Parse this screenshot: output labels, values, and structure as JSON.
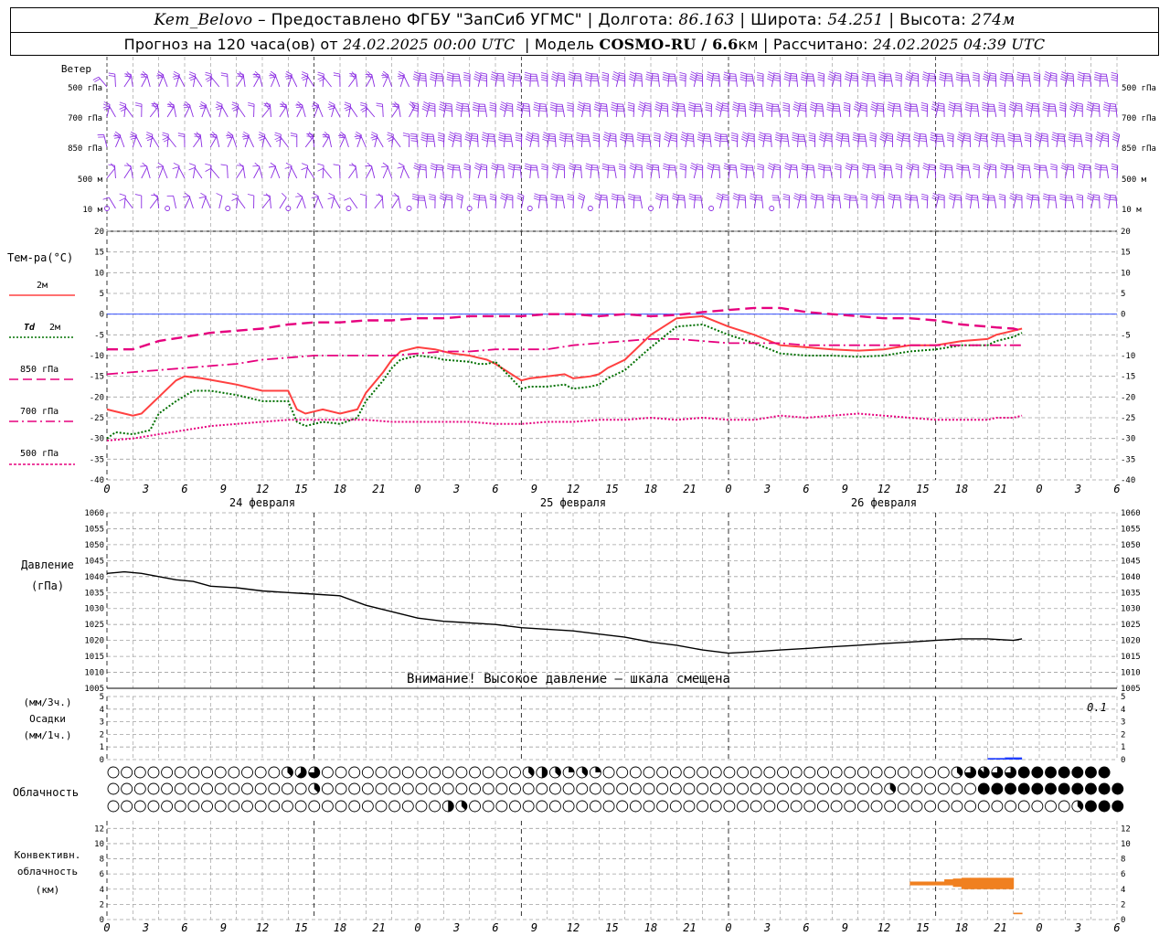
{
  "header": {
    "station": "Kem_Belovo",
    "provided_by": " – Предоставлено ФГБУ \"ЗапСиб УГМС\" ",
    "lon_label": "Долгота:",
    "lon_value": "86.163",
    "lat_label": "Широта:",
    "lat_value": "54.251",
    "alt_label": "Высота:",
    "alt_value": "274м",
    "forecast_label": "Прогноз на 120 часа(ов) от",
    "forecast_start": "24.02.2025 00:00 UTC",
    "model_label": "Модель",
    "model_name": "COSMO-RU / 6.6",
    "model_unit": "км",
    "calc_label": "Рассчитано:",
    "calc_time": "24.02.2025 04:39 UTC"
  },
  "colors": {
    "wind": "#8a2be2",
    "t2m": "#ff4040",
    "td2m": "#007000",
    "t850": "#e6007e",
    "t700": "#e6007e",
    "t500": "#e6007e",
    "pressure": "#000000",
    "precip": "#1e3cff",
    "convective": "#f08020",
    "grid": "#a0a0a0",
    "zero_line": "#1e3cff"
  },
  "wind_panel": {
    "title": "Ветер",
    "levels": [
      "500 гПа",
      "700 гПа",
      "850 гПа",
      "500 м",
      "10   м"
    ]
  },
  "time_axis": {
    "hours": [
      "0",
      "3",
      "6",
      "9",
      "12",
      "15",
      "18",
      "21",
      "0",
      "3",
      "6",
      "9",
      "12",
      "15",
      "18",
      "21",
      "0",
      "3",
      "6",
      "9",
      "12",
      "15",
      "18",
      "21",
      "0",
      "3",
      "6"
    ],
    "dates": [
      "24 февраля",
      "25 февраля",
      "26 февраля"
    ]
  },
  "legend": {
    "title": "Тем-ра(°C)",
    "items": [
      {
        "label": "2м",
        "prefix": ""
      },
      {
        "label": "2м",
        "prefix": "Td"
      },
      {
        "label": "850 гПа",
        "prefix": ""
      },
      {
        "label": "700 гПа",
        "prefix": ""
      },
      {
        "label": "500 гПа",
        "prefix": ""
      }
    ]
  },
  "labels": {
    "pressure_title": "Давление",
    "pressure_unit": "(гПа)",
    "pressure_warning": "Внимание! Высокое давление – шкала смещена",
    "precip_unit_3h": "(мм/3ч.)",
    "precip_title": "Осадки",
    "precip_unit_1h": "(мм/1ч.)",
    "precip_max": "0.1",
    "cloud_title": "Облачность",
    "conv_title_1": "Конвективн.",
    "conv_title_2": "облачность",
    "conv_unit": "(км)"
  },
  "chart_data": [
    {
      "type": "line",
      "title": "Тем-ра(°C)",
      "x_unit": "hours since 24.02.2025 00:00 UTC",
      "ylim": [
        -40,
        20
      ],
      "yticks": [
        20,
        15,
        10,
        5,
        0,
        -5,
        -10,
        -15,
        -20,
        -25,
        -30,
        -35,
        -40
      ],
      "grid": true,
      "series": [
        {
          "name": "2м",
          "style": "solid",
          "x": [
            0,
            3,
            4,
            6,
            8,
            9,
            11,
            15,
            18,
            21,
            22,
            23,
            24,
            25,
            27,
            29,
            30,
            32,
            33,
            34,
            36,
            38,
            39,
            40,
            42,
            43,
            44,
            45,
            48,
            49,
            51,
            53,
            54,
            56,
            57,
            58,
            60,
            63,
            66,
            69,
            72,
            75,
            78,
            81,
            84,
            87,
            90,
            93,
            96,
            99,
            102,
            103,
            105,
            106
          ],
          "y": [
            -23,
            -24.5,
            -24,
            -20,
            -16,
            -15,
            -15.5,
            -17,
            -18.5,
            -18.5,
            -23,
            -24,
            -23.5,
            -23,
            -24,
            -23,
            -19,
            -14,
            -11,
            -9,
            -8,
            -8.5,
            -9,
            -9.5,
            -10,
            -10.5,
            -11,
            -12,
            -16,
            -15.5,
            -15,
            -14.5,
            -15.5,
            -15,
            -14.5,
            -13,
            -11,
            -5,
            -1,
            -0.5,
            -3,
            -5,
            -7.5,
            -8,
            -8.5,
            -8.8,
            -8.5,
            -7.5,
            -7.5,
            -6.5,
            -6,
            -5,
            -4,
            -3.5
          ]
        },
        {
          "name": "Td 2м",
          "style": "dotted",
          "x": [
            0,
            1,
            3,
            5,
            6,
            8,
            10,
            12,
            15,
            18,
            21,
            22,
            23,
            24,
            25,
            27,
            29,
            30,
            32,
            33,
            34,
            36,
            38,
            39,
            42,
            43,
            44,
            45,
            48,
            49,
            51,
            53,
            54,
            56,
            57,
            58,
            60,
            63,
            66,
            69,
            72,
            75,
            78,
            81,
            84,
            87,
            90,
            93,
            96,
            99,
            102,
            103,
            105,
            106
          ],
          "y": [
            -30,
            -28.5,
            -29,
            -28,
            -24,
            -21,
            -18.5,
            -18.5,
            -19.5,
            -21,
            -21,
            -26,
            -27,
            -26.5,
            -26,
            -26.5,
            -25,
            -21,
            -16,
            -13,
            -11,
            -10,
            -10.5,
            -11,
            -11.5,
            -12,
            -12,
            -11.5,
            -18,
            -17.5,
            -17.5,
            -17,
            -18,
            -17.5,
            -17,
            -15.5,
            -13.5,
            -8,
            -3,
            -2.5,
            -5,
            -7,
            -9.5,
            -10,
            -10,
            -10.3,
            -10,
            -9,
            -8.5,
            -7.5,
            -7.5,
            -6.5,
            -5.5,
            -4.5
          ]
        },
        {
          "name": "850 гПа",
          "style": "long-dash",
          "x": [
            0,
            3,
            6,
            9,
            12,
            15,
            18,
            21,
            24,
            27,
            30,
            33,
            36,
            39,
            42,
            45,
            48,
            51,
            54,
            57,
            60,
            63,
            66,
            69,
            72,
            75,
            78,
            81,
            84,
            87,
            90,
            93,
            96,
            99,
            102,
            103,
            105,
            106
          ],
          "y": [
            -8.5,
            -8.5,
            -6.5,
            -5.5,
            -4.5,
            -4,
            -3.5,
            -2.5,
            -2,
            -2,
            -1.5,
            -1.5,
            -1,
            -1,
            -0.5,
            -0.5,
            -0.5,
            0,
            0,
            -0.5,
            0,
            -0.5,
            -0.2,
            0.5,
            1,
            1.5,
            1.5,
            0.5,
            0,
            -0.5,
            -1,
            -1,
            -1.5,
            -2.5,
            -3,
            -3.2,
            -3.5,
            -4
          ]
        },
        {
          "name": "700 гПа",
          "style": "dash-dot",
          "x": [
            0,
            3,
            6,
            9,
            12,
            15,
            18,
            21,
            24,
            27,
            30,
            33,
            36,
            39,
            42,
            45,
            48,
            51,
            54,
            57,
            60,
            63,
            66,
            69,
            72,
            75,
            78,
            81,
            84,
            87,
            90,
            93,
            96,
            99,
            102,
            103,
            105,
            106
          ],
          "y": [
            -14.5,
            -14,
            -13.5,
            -13,
            -12.5,
            -12,
            -11,
            -10.5,
            -10,
            -10,
            -10,
            -10,
            -9.5,
            -9,
            -9,
            -8.5,
            -8.5,
            -8.5,
            -7.5,
            -7,
            -6.5,
            -6,
            -6,
            -6.5,
            -7,
            -7,
            -7,
            -7.5,
            -7.5,
            -7.5,
            -7.5,
            -7.5,
            -7.5,
            -7.5,
            -7.5,
            -7.5,
            -7.5,
            -7.5
          ]
        },
        {
          "name": "500 гПа",
          "style": "dense-dot",
          "x": [
            0,
            3,
            6,
            9,
            12,
            15,
            18,
            21,
            24,
            27,
            30,
            33,
            36,
            39,
            42,
            45,
            48,
            51,
            54,
            57,
            60,
            63,
            66,
            69,
            72,
            75,
            78,
            81,
            84,
            87,
            90,
            93,
            96,
            99,
            102,
            103,
            105,
            106
          ],
          "y": [
            -30.5,
            -30,
            -29,
            -28,
            -27,
            -26.5,
            -26,
            -25.5,
            -25.5,
            -25.5,
            -25.5,
            -26,
            -26,
            -26,
            -26,
            -26.5,
            -26.5,
            -26,
            -26,
            -25.5,
            -25.5,
            -25,
            -25.5,
            -25,
            -25.5,
            -25.5,
            -24.5,
            -25,
            -24.5,
            -24,
            -24.5,
            -25,
            -25.5,
            -25.5,
            -25.5,
            -25,
            -25,
            -24.5
          ]
        }
      ]
    },
    {
      "type": "line",
      "title": "Давление",
      "ylabel": "(гПа)",
      "ylim": [
        1005,
        1060
      ],
      "yticks": [
        1060,
        1055,
        1050,
        1045,
        1040,
        1035,
        1030,
        1025,
        1020,
        1015,
        1010,
        1005
      ],
      "grid": true,
      "series": [
        {
          "name": "Давление",
          "x": [
            0,
            2,
            4,
            6,
            8,
            10,
            12,
            15,
            18,
            21,
            24,
            27,
            30,
            33,
            36,
            39,
            42,
            45,
            48,
            51,
            54,
            57,
            60,
            63,
            66,
            69,
            72,
            75,
            78,
            81,
            84,
            87,
            90,
            93,
            96,
            99,
            102,
            105,
            106
          ],
          "y": [
            1041,
            1041.5,
            1041,
            1040,
            1039,
            1038.5,
            1037,
            1036.5,
            1035.5,
            1035,
            1034.5,
            1034,
            1031,
            1029,
            1027,
            1026,
            1025.5,
            1025,
            1024,
            1023.5,
            1023,
            1022,
            1021,
            1019.5,
            1018.5,
            1017,
            1016,
            1016.5,
            1017,
            1017.5,
            1018,
            1018.5,
            1019,
            1019.5,
            1020,
            1020.5,
            1020.5,
            1020,
            1020.5
          ]
        }
      ]
    },
    {
      "type": "bar",
      "title": "Осадки",
      "ylim": [
        0,
        5
      ],
      "yticks": [
        5,
        4,
        3,
        2,
        1,
        0
      ],
      "max_label": "0.1",
      "series": [
        {
          "name": "Осадки",
          "x": [
            102,
            103,
            104,
            105
          ],
          "values": [
            0.05,
            0.05,
            0.1,
            0.1
          ]
        }
      ]
    },
    {
      "type": "table",
      "title": "Облачность",
      "rows": 3,
      "columns": 36,
      "note": "cloud cover per 3h step (0–8 octas), rows top to bottom",
      "values": [
        [
          0,
          0,
          0,
          0,
          0,
          0,
          0,
          0,
          0,
          0,
          0,
          0,
          0,
          3,
          5,
          6,
          0,
          0,
          0,
          0,
          0,
          0,
          0,
          0,
          0,
          0,
          0,
          0,
          0,
          0,
          0,
          3,
          4,
          3,
          2,
          3,
          2,
          0,
          0,
          0,
          0,
          0,
          0,
          0,
          0,
          0,
          0,
          0,
          0,
          0,
          0,
          0,
          0,
          0,
          0,
          0,
          0,
          0,
          0,
          0,
          0,
          0,
          0,
          3,
          6,
          7,
          6,
          6,
          8,
          8,
          8,
          8,
          8,
          8,
          8
        ],
        [
          0,
          0,
          0,
          0,
          0,
          0,
          0,
          0,
          0,
          0,
          0,
          0,
          0,
          0,
          0,
          3,
          0,
          0,
          0,
          0,
          0,
          0,
          0,
          0,
          0,
          0,
          0,
          0,
          0,
          0,
          0,
          0,
          0,
          0,
          0,
          0,
          0,
          0,
          0,
          0,
          0,
          0,
          0,
          0,
          0,
          0,
          0,
          0,
          0,
          0,
          0,
          0,
          0,
          0,
          0,
          0,
          0,
          0,
          3,
          0,
          0,
          0,
          0,
          0,
          0,
          8,
          8,
          8,
          8,
          8,
          8,
          8,
          8,
          8,
          8,
          8,
          8
        ],
        [
          0,
          0,
          0,
          0,
          0,
          0,
          0,
          0,
          0,
          0,
          0,
          0,
          0,
          0,
          0,
          0,
          0,
          0,
          0,
          0,
          0,
          0,
          0,
          0,
          0,
          4,
          3,
          0,
          0,
          0,
          0,
          0,
          0,
          0,
          0,
          0,
          0,
          0,
          0,
          0,
          0,
          0,
          0,
          0,
          0,
          0,
          0,
          0,
          0,
          0,
          0,
          0,
          0,
          0,
          0,
          0,
          0,
          0,
          0,
          0,
          0,
          0,
          0,
          0,
          0,
          0,
          0,
          0,
          0,
          0,
          0,
          0,
          3,
          8,
          8,
          8,
          8
        ]
      ]
    },
    {
      "type": "bar",
      "title": "Конвективн. облачность",
      "ylabel": "(км)",
      "ylim": [
        0,
        13
      ],
      "yticks": [
        12,
        10,
        8,
        6,
        4,
        2,
        0
      ],
      "series": [
        {
          "name": "convective_base_top",
          "x": [
            93,
            94,
            95,
            96,
            97,
            98,
            99,
            100,
            101,
            102,
            103,
            104,
            105
          ],
          "bottom": [
            4.5,
            4.5,
            4.5,
            4.5,
            4.5,
            4.3,
            4.0,
            4.0,
            4.0,
            4.0,
            4.0,
            4.0,
            0.7
          ],
          "top": [
            5.0,
            5.0,
            5.0,
            5.0,
            5.3,
            5.4,
            5.5,
            5.5,
            5.5,
            5.5,
            5.5,
            5.5,
            0.9
          ]
        }
      ]
    }
  ]
}
